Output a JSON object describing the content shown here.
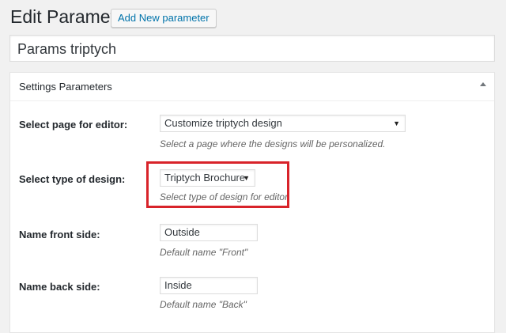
{
  "header": {
    "title": "Edit Parameter",
    "add_new_label": "Add New parameter"
  },
  "title_field": {
    "value": "Params triptych"
  },
  "settings_box": {
    "title": "Settings Parameters",
    "rows": {
      "page": {
        "label": "Select page for editor:",
        "selected": "Customize triptych design",
        "description": "Select a page where the designs will be personalized."
      },
      "design_type": {
        "label": "Select type of design:",
        "selected": "Triptych Brochure",
        "description": "Select type of design for editor."
      },
      "front_side": {
        "label": "Name front side:",
        "value": "Outside",
        "description": "Default name \"Front\""
      },
      "back_side": {
        "label": "Name back side:",
        "value": "Inside",
        "description": "Default name \"Back\""
      }
    }
  },
  "colors": {
    "link": "#0073aa",
    "highlight": "#d8232a"
  }
}
